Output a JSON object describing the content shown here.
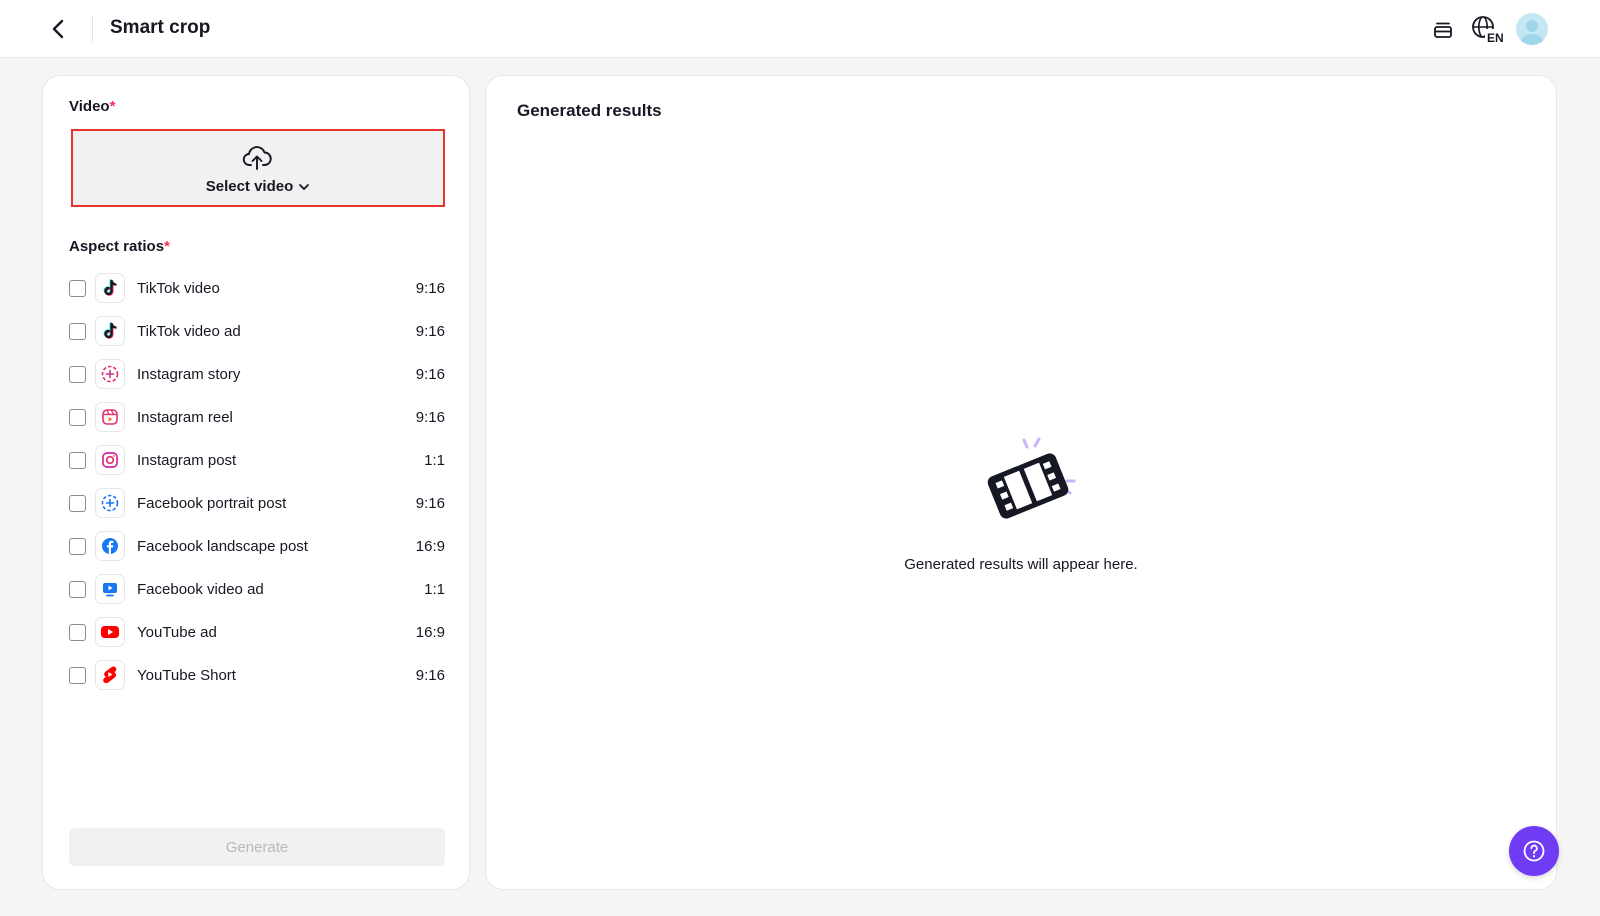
{
  "header": {
    "title": "Smart crop",
    "language_code": "EN"
  },
  "video_field": {
    "label": "Video",
    "required_mark": "*",
    "select_label": "Select video"
  },
  "aspect_field": {
    "label": "Aspect ratios",
    "required_mark": "*",
    "items": [
      {
        "icon": "tiktok-icon",
        "label": "TikTok video",
        "ratio": "9:16"
      },
      {
        "icon": "tiktok-icon",
        "label": "TikTok video ad",
        "ratio": "9:16"
      },
      {
        "icon": "instagram-story-icon",
        "label": "Instagram story",
        "ratio": "9:16"
      },
      {
        "icon": "instagram-reel-icon",
        "label": "Instagram reel",
        "ratio": "9:16"
      },
      {
        "icon": "instagram-icon",
        "label": "Instagram post",
        "ratio": "1:1"
      },
      {
        "icon": "facebook-story-icon",
        "label": "Facebook portrait post",
        "ratio": "9:16"
      },
      {
        "icon": "facebook-icon",
        "label": "Facebook landscape post",
        "ratio": "16:9"
      },
      {
        "icon": "facebook-video-icon",
        "label": "Facebook video ad",
        "ratio": "1:1"
      },
      {
        "icon": "youtube-icon",
        "label": "YouTube ad",
        "ratio": "16:9"
      },
      {
        "icon": "youtube-shorts-icon",
        "label": "YouTube Short",
        "ratio": "9:16"
      }
    ]
  },
  "generate_label": "Generate",
  "results": {
    "title": "Generated results",
    "empty_message": "Generated results will appear here."
  },
  "colors": {
    "accent": "#6f3bf5",
    "required": "#fe2c55",
    "highlight_border": "#e8352c"
  }
}
